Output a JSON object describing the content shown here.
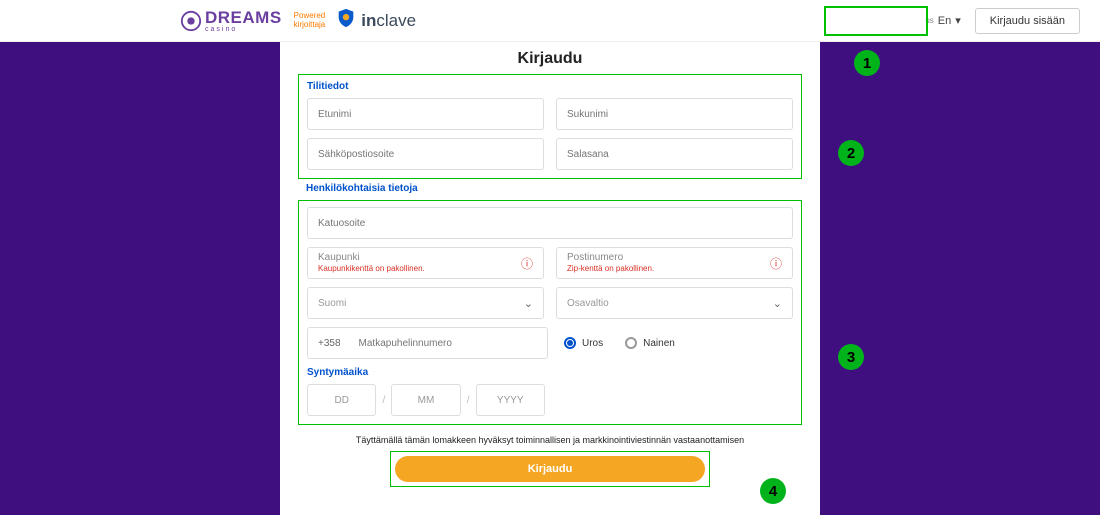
{
  "header": {
    "brand": "DREAMS",
    "brand_sub": "casino",
    "powered_line1": "Powered",
    "powered_line2": "kirjoittaja",
    "partner": "inclave",
    "lang_flag": "us",
    "lang_label": "En",
    "login_btn": "Kirjaudu sisään"
  },
  "page": {
    "title": "Kirjaudu",
    "consent": "Täyttämällä tämän lomakkeen hyväksyt toiminnallisen ja markkinointiviestinnän vastaanottamisen",
    "submit": "Kirjaudu"
  },
  "sections": {
    "account": {
      "title": "Tilitiedot",
      "firstname_ph": "Etunimi",
      "lastname_ph": "Sukunimi",
      "email_ph": "Sähköpostiosoite",
      "password_ph": "Salasana"
    },
    "personal": {
      "title": "Henkilökohtaisia tietoja",
      "address_ph": "Katuosoite",
      "city_label": "Kaupunki",
      "city_err": "Kaupunkikenttä on pakollinen.",
      "zip_label": "Postinumero",
      "zip_err": "Zip-kenttä on pakollinen.",
      "country_value": "Suomi",
      "state_value": "Osavaltio",
      "phone_prefix": "+358",
      "phone_ph": "Matkapuhelinnumero",
      "gender_male": "Uros",
      "gender_female": "Nainen"
    },
    "dob": {
      "title": "Syntymäaika",
      "dd": "DD",
      "mm": "MM",
      "yyyy": "YYYY"
    }
  },
  "annotations": {
    "n1": "1",
    "n2": "2",
    "n3": "3",
    "n4": "4"
  }
}
